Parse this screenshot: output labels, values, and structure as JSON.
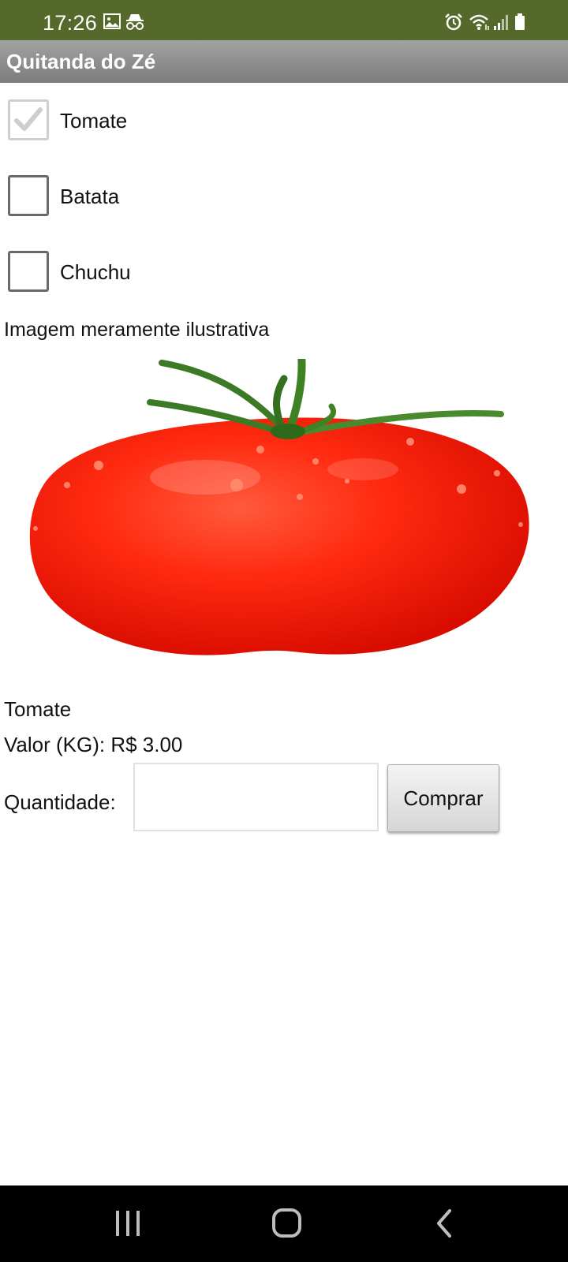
{
  "status_bar": {
    "time": "17:26",
    "icons": [
      "image-icon",
      "incognito-icon",
      "alarm-icon",
      "wifi-icon",
      "signal-icon",
      "battery-icon"
    ]
  },
  "app_bar": {
    "title": "Quitanda do Zé"
  },
  "products": [
    {
      "label": "Tomate",
      "checked": true
    },
    {
      "label": "Batata",
      "checked": false
    },
    {
      "label": "Chuchu",
      "checked": false
    }
  ],
  "caption": "Imagem meramente ilustrativa",
  "selected_product": {
    "name": "Tomate",
    "price_text": "Valor (KG): R$ 3.00"
  },
  "quantity": {
    "label": "Quantidade:",
    "value": "",
    "placeholder": ""
  },
  "buy_button": {
    "label": "Comprar"
  },
  "nav_bar": {
    "icons": [
      "recent-apps-icon",
      "home-icon",
      "back-icon"
    ]
  },
  "colors": {
    "status_bar": "#55692a",
    "app_bar": "#8e8e8e",
    "tomato": "#ff2a10"
  }
}
